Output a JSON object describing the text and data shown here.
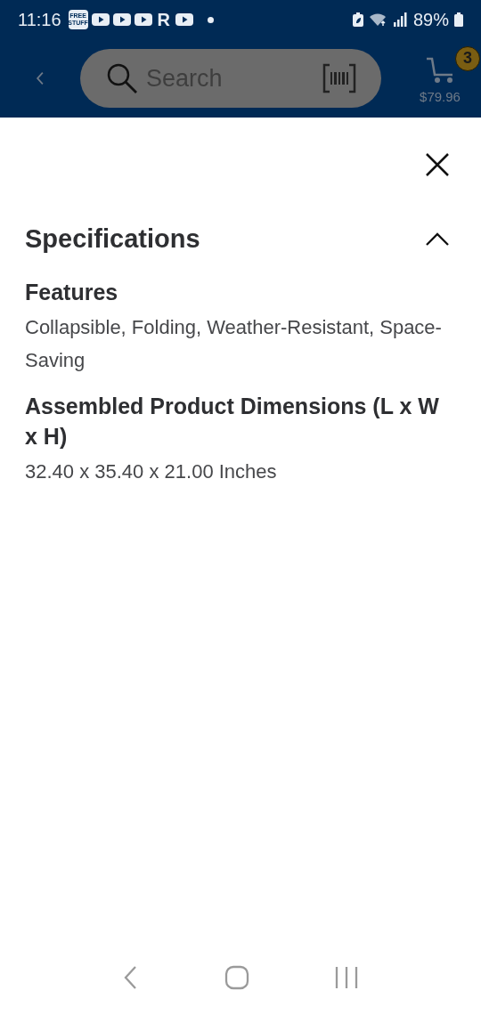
{
  "status_bar": {
    "time": "11:16",
    "notification_icons": [
      {
        "kind": "text-badge",
        "label": "FREE STUFF"
      },
      {
        "kind": "play"
      },
      {
        "kind": "play"
      },
      {
        "kind": "play"
      },
      {
        "kind": "letter",
        "label": "R"
      },
      {
        "kind": "play"
      },
      {
        "kind": "dot"
      }
    ],
    "battery": "89%"
  },
  "header": {
    "search": {
      "placeholder": "Search"
    },
    "cart": {
      "count": "3",
      "total": "$79.96"
    }
  },
  "sheet": {
    "section": {
      "title": "Specifications",
      "expanded": true,
      "specs": [
        {
          "label": "Features",
          "value": "Collapsible, Folding, Weather-Resistant, Space-Saving"
        },
        {
          "label": "Assembled Product Dimensions (L x W x H)",
          "value": "32.40 x 35.40 x 21.00 Inches"
        }
      ]
    }
  }
}
